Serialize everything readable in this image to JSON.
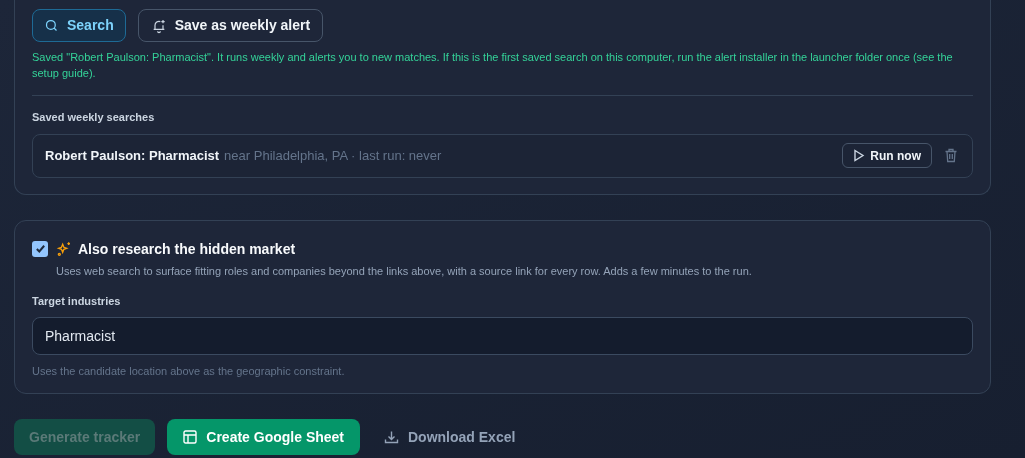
{
  "search_button": {
    "label": "Search",
    "selected": true
  },
  "alert_button": {
    "label": "Save as weekly alert"
  },
  "saved_message": "Saved \"Robert Paulson: Pharmacist\". It runs weekly and alerts you to new matches. If this is the first saved search on this computer, run the alert installer in the launcher folder once (see the setup guide).",
  "saved_searches": {
    "title": "Saved weekly searches",
    "items": [
      {
        "name": "Robert Paulson: Pharmacist",
        "detail": "near Philadelphia, PA · last run: never",
        "run_label": "Run now"
      }
    ]
  },
  "hidden_market": {
    "checked": true,
    "title": "Also research the hidden market",
    "description": "Uses web search to surface fitting roles and companies beyond the links above, with a source link for every row. Adds a few minutes to the run.",
    "field_label": "Target industries",
    "field_value": "Pharmacist",
    "hint": "Uses the candidate location above as the geographic constraint."
  },
  "actions": [
    {
      "kind": "primary",
      "label": "Generate tracker",
      "disabled": true
    },
    {
      "kind": "sheet",
      "label": "Create Google Sheet",
      "disabled": false
    },
    {
      "kind": "download",
      "label": "Download Excel",
      "disabled": false
    }
  ]
}
